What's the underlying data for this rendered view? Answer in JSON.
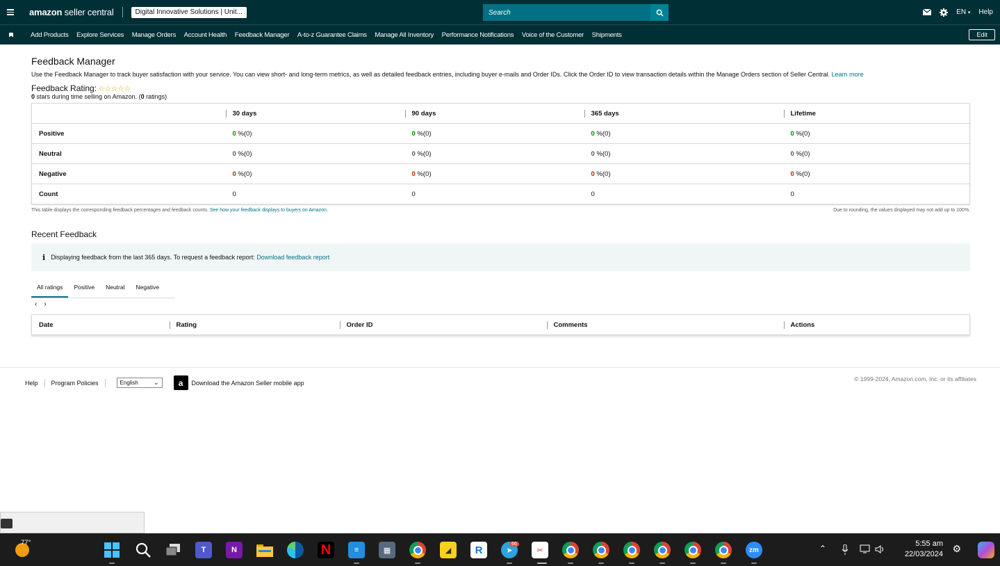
{
  "topbar": {
    "logo_brand": "amazon",
    "logo_product": "seller central",
    "account": "Digital Innovative Solutions | Unit...",
    "search_placeholder": "Search",
    "language": "EN",
    "help": "Help"
  },
  "subnav": {
    "items": [
      "Add Products",
      "Explore Services",
      "Manage Orders",
      "Account Health",
      "Feedback Manager",
      "A-to-z Guarantee Claims",
      "Manage All Inventory",
      "Performance Notifications",
      "Voice of the Customer",
      "Shipments"
    ],
    "edit": "Edit"
  },
  "page": {
    "title": "Feedback Manager",
    "description": "Use the Feedback Manager to track buyer satisfaction with your service. You can view short- and long-term metrics, as well as detailed feedback entries, including buyer e-mails and Order IDs. Click the Order ID to view transaction details within the Manage Orders section of Seller Central.",
    "learn_more": "Learn more",
    "rating_label": "Feedback Rating:",
    "stars": "☆☆☆☆☆",
    "stars_count": "0",
    "stars_text": " stars during time selling on Amazon. (",
    "ratings_count": "0",
    "ratings_text": " ratings)"
  },
  "metrics_table": {
    "headers": [
      "30 days",
      "90 days",
      "365 days",
      "Lifetime"
    ],
    "rows": [
      {
        "label": "Positive",
        "kind": "pos",
        "cells": [
          {
            "v": "0",
            "s": " %(0)"
          },
          {
            "v": "0",
            "s": " %(0)"
          },
          {
            "v": "0",
            "s": " %(0)"
          },
          {
            "v": "0",
            "s": " %(0)"
          }
        ]
      },
      {
        "label": "Neutral",
        "kind": "neu",
        "cells": [
          {
            "v": "0",
            "s": " %(0)"
          },
          {
            "v": "0",
            "s": " %(0)"
          },
          {
            "v": "0",
            "s": " %(0)"
          },
          {
            "v": "0",
            "s": " %(0)"
          }
        ]
      },
      {
        "label": "Negative",
        "kind": "neg",
        "cells": [
          {
            "v": "0",
            "s": " %(0)"
          },
          {
            "v": "0",
            "s": " %(0)"
          },
          {
            "v": "0",
            "s": " %(0)"
          },
          {
            "v": "0",
            "s": " %(0)"
          }
        ]
      },
      {
        "label": "Count",
        "kind": "count",
        "cells": [
          {
            "v": "",
            "s": "0"
          },
          {
            "v": "",
            "s": "0"
          },
          {
            "v": "",
            "s": "0"
          },
          {
            "v": "",
            "s": "0"
          }
        ]
      }
    ],
    "note_left": "This table displays the corresponding feedback percentages and feedback counts.",
    "note_link": "See how your feedback displays to buyers on Amazon.",
    "note_right": "Due to rounding, the values displayed may not add up to 100%."
  },
  "recent": {
    "title": "Recent Feedback",
    "info_text": "Displaying feedback from the last 365 days. To request a feedback report:",
    "info_link": "Download feedback report",
    "tabs": [
      "All ratings",
      "Positive",
      "Neutral",
      "Negative"
    ],
    "columns": [
      "Date",
      "Rating",
      "Order ID",
      "Comments",
      "Actions"
    ]
  },
  "footer": {
    "help": "Help",
    "policies": "Program Policies",
    "language": "English",
    "app_text": "Download the Amazon Seller mobile app",
    "copyright": "© 1999-2024, Amazon.com, Inc. or its affiliates"
  },
  "taskbar": {
    "temperature": "77°",
    "telegram_badge": "66",
    "time": "5:55 am",
    "date": "22/03/2024"
  }
}
